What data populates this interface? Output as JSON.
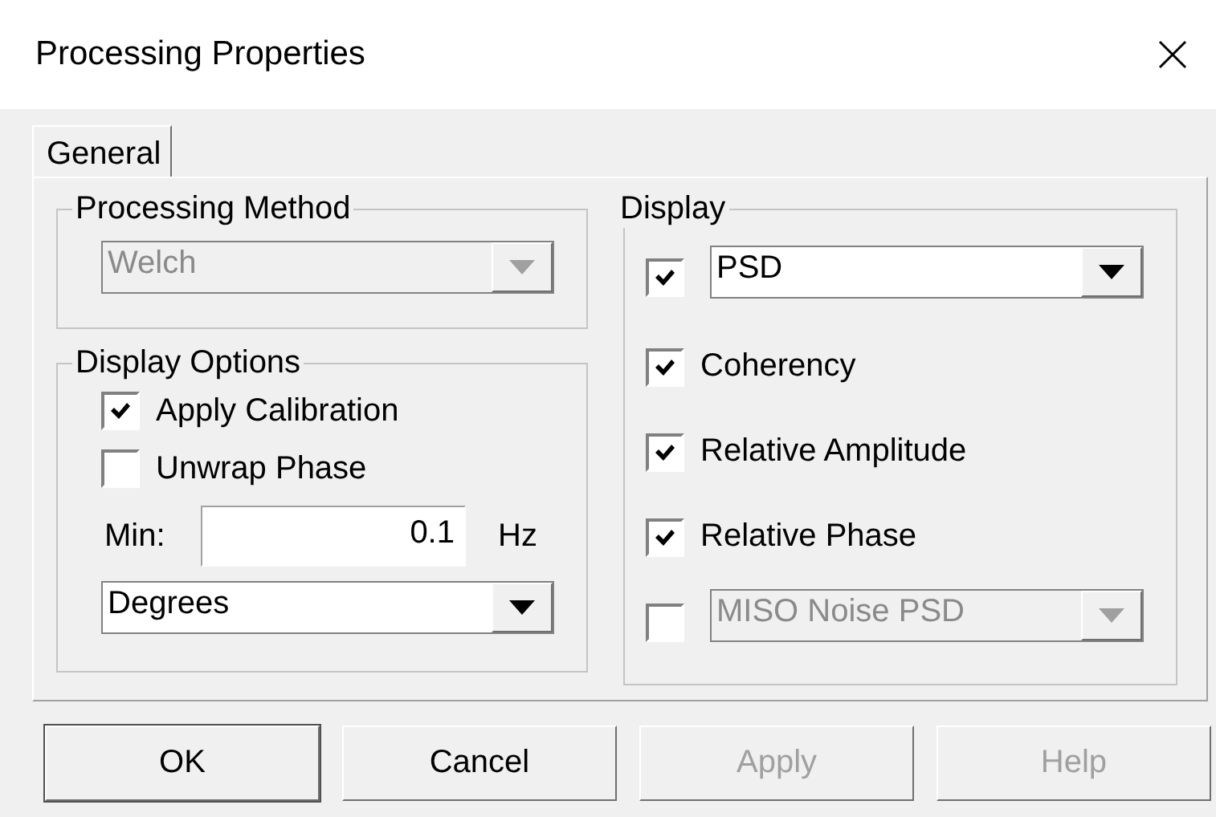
{
  "window": {
    "title": "Processing Properties"
  },
  "tabs": [
    {
      "label": "General",
      "selected": true
    }
  ],
  "processing_method": {
    "title": "Processing Method",
    "dropdown": {
      "value": "Welch",
      "disabled": true
    }
  },
  "display_options": {
    "title": "Display Options",
    "checkboxes": [
      {
        "label": "Apply Calibration",
        "checked": true
      },
      {
        "label": "Unwrap Phase",
        "checked": false
      }
    ],
    "min": {
      "label": "Min:",
      "value": "0.1",
      "unit": "Hz"
    },
    "dropdown": {
      "value": "Degrees",
      "disabled": false
    }
  },
  "display": {
    "title": "Display",
    "items": [
      {
        "kind": "dropdown",
        "value": "PSD",
        "checked": true,
        "disabled": false
      },
      {
        "kind": "checkbox",
        "label": "Coherency",
        "checked": true
      },
      {
        "kind": "checkbox",
        "label": "Relative Amplitude",
        "checked": true
      },
      {
        "kind": "checkbox",
        "label": "Relative Phase",
        "checked": true
      },
      {
        "kind": "dropdown",
        "value": "MISO Noise PSD",
        "checked": false,
        "disabled": true
      }
    ]
  },
  "buttons": [
    {
      "label": "OK",
      "disabled": false,
      "default": true
    },
    {
      "label": "Cancel",
      "disabled": false,
      "default": false
    },
    {
      "label": "Apply",
      "disabled": true,
      "default": false
    },
    {
      "label": "Help",
      "disabled": true,
      "default": false
    }
  ]
}
